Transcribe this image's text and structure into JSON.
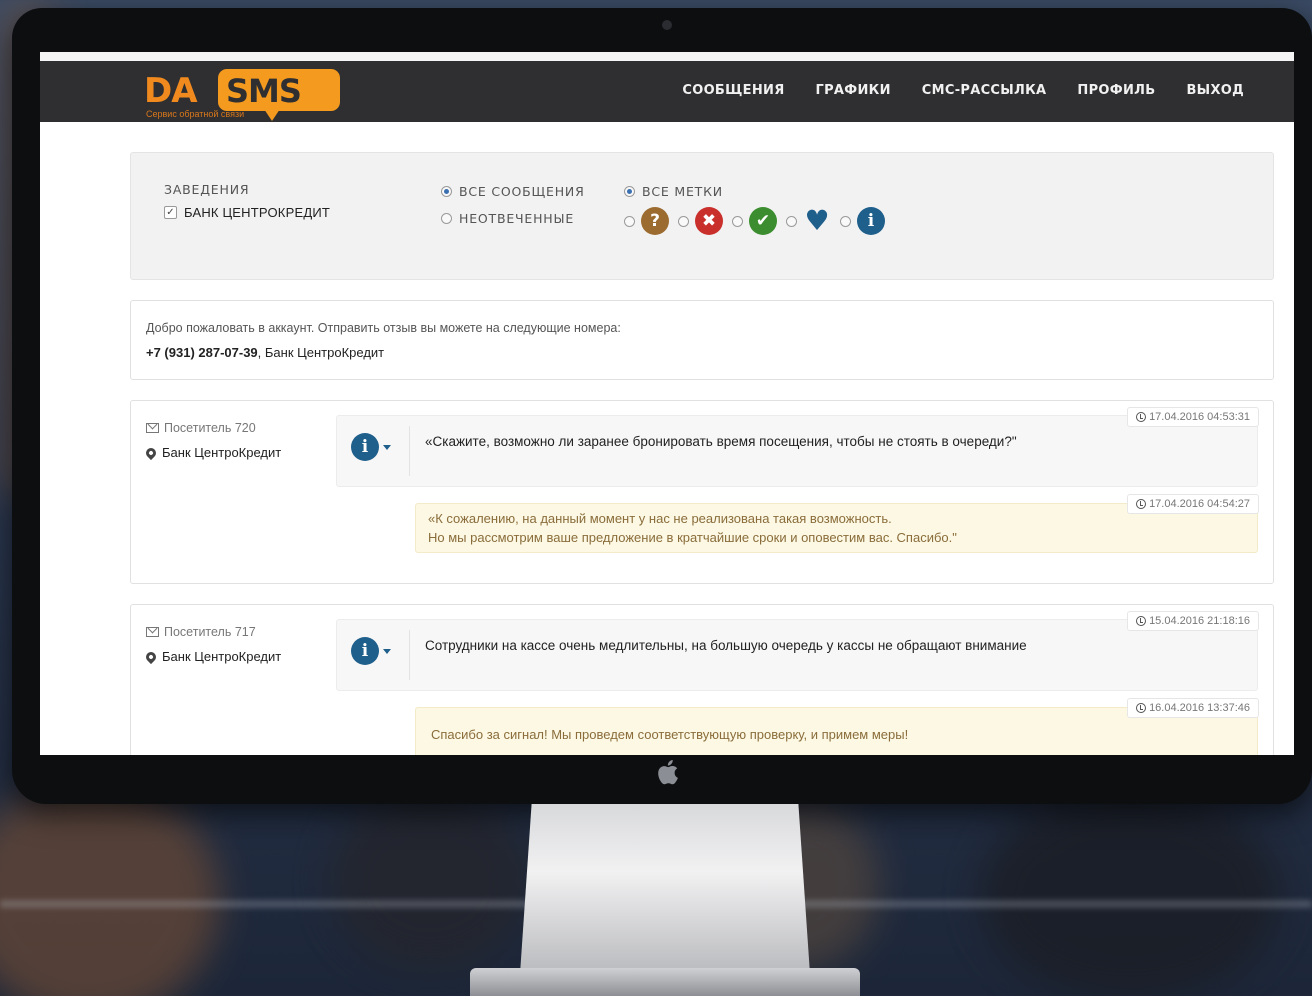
{
  "nav": {
    "items": [
      "СООБЩЕНИЯ",
      "ГРАФИКИ",
      "СМС-РАССЫЛКА",
      "ПРОФИЛЬ",
      "ВЫХОД"
    ]
  },
  "logo": {
    "text_da": "DA",
    "text_sms": "SMS",
    "subtitle": "Сервис обратной связи"
  },
  "filters": {
    "establishments_title": "ЗАВЕДЕНИЯ",
    "establishment_option": "БАНК ЦЕНТРОКРЕДИТ",
    "establishment_checked": true,
    "messages_all": "ВСЕ СООБЩЕНИЯ",
    "messages_unanswered": "НЕОТВЕЧЕННЫЕ",
    "tags_all": "ВСЕ МЕТКИ",
    "tags": [
      {
        "icon": "question-icon",
        "glyph": "?",
        "color": "#9b6b2f"
      },
      {
        "icon": "cross-icon",
        "glyph": "✖",
        "color": "#c9302c"
      },
      {
        "icon": "check-icon",
        "glyph": "✔",
        "color": "#3c8d2f"
      },
      {
        "icon": "heart-icon",
        "glyph": "♥",
        "color": "#1f5f8b"
      },
      {
        "icon": "info-icon",
        "glyph": "i",
        "color": "#1f5f8b"
      }
    ]
  },
  "welcome": {
    "line1": "Добро пожаловать в аккаунт. Отправить отзыв вы можете на следующие номера:",
    "phone": "+7 (931) 287-07-39",
    "bank": ", Банк ЦентроКредит"
  },
  "messages": [
    {
      "visitor": "Посетитель 720",
      "place": "Банк ЦентроКредит",
      "question_time": "17.04.2016 04:53:31",
      "question": "«Скажите, возможно ли заранее бронировать время посещения, чтобы не стоять в очереди?\"",
      "answer_time": "17.04.2016 04:54:27",
      "answer_line1": "«К сожалению, на данный момент у нас не реализована такая возможность.",
      "answer_line2": "Но мы рассмотрим ваше предложение в кратчайшие сроки и оповестим вас. Спасибо.\""
    },
    {
      "visitor": "Посетитель 717",
      "place": "Банк ЦентроКредит",
      "question_time": "15.04.2016 21:18:16",
      "question": "Сотрудники на кассе очень медлительны, на большую очередь у кассы не обращают внимание",
      "answer_time": "16.04.2016 13:37:46",
      "answer_line1": "Спасибо за сигнал! Мы проведем соответствующую проверку, и примем меры!"
    }
  ],
  "colors": {
    "brand_orange": "#f39a1f",
    "topbar": "#2f2f31",
    "info_blue": "#1f5f8b",
    "answer_bg": "#fcf8e3"
  }
}
